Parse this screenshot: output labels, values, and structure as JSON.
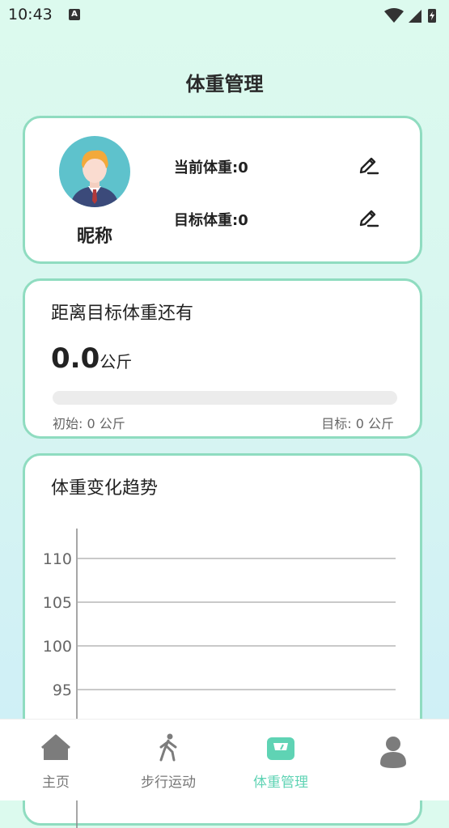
{
  "status": {
    "time": "10:43",
    "keyboard_badge": "A"
  },
  "header": {
    "title": "体重管理"
  },
  "profile": {
    "nickname": "昵称",
    "current_weight_label": "当前体重:",
    "current_weight_value": "0",
    "target_weight_label": "目标体重:",
    "target_weight_value": "0",
    "edit_icon": "edit-pencil-icon"
  },
  "goal": {
    "heading": "距离目标体重还有",
    "remaining_value": "0.0",
    "remaining_unit": "公斤",
    "progress_fraction": 0,
    "start_text": "初始:  0  公斤",
    "target_text": "目标:  0  公斤"
  },
  "trend": {
    "heading": "体重变化趋势",
    "chart_data": {
      "type": "line",
      "title": "体重变化趋势",
      "xlabel": "",
      "ylabel": "",
      "y_ticks": [
        95,
        100,
        105,
        110
      ],
      "grid": true,
      "series": []
    }
  },
  "tabs": [
    {
      "label": "主页",
      "icon": "home-icon",
      "active": false
    },
    {
      "label": "步行运动",
      "icon": "walking-icon",
      "active": false
    },
    {
      "label": "体重管理",
      "icon": "scale-icon",
      "active": true
    },
    {
      "label": "",
      "icon": "profile-icon",
      "active": false
    }
  ],
  "colors": {
    "accent": "#5fd3b4",
    "card_border": "#8fdcc0",
    "avatar_bg": "#5ec2cc"
  }
}
